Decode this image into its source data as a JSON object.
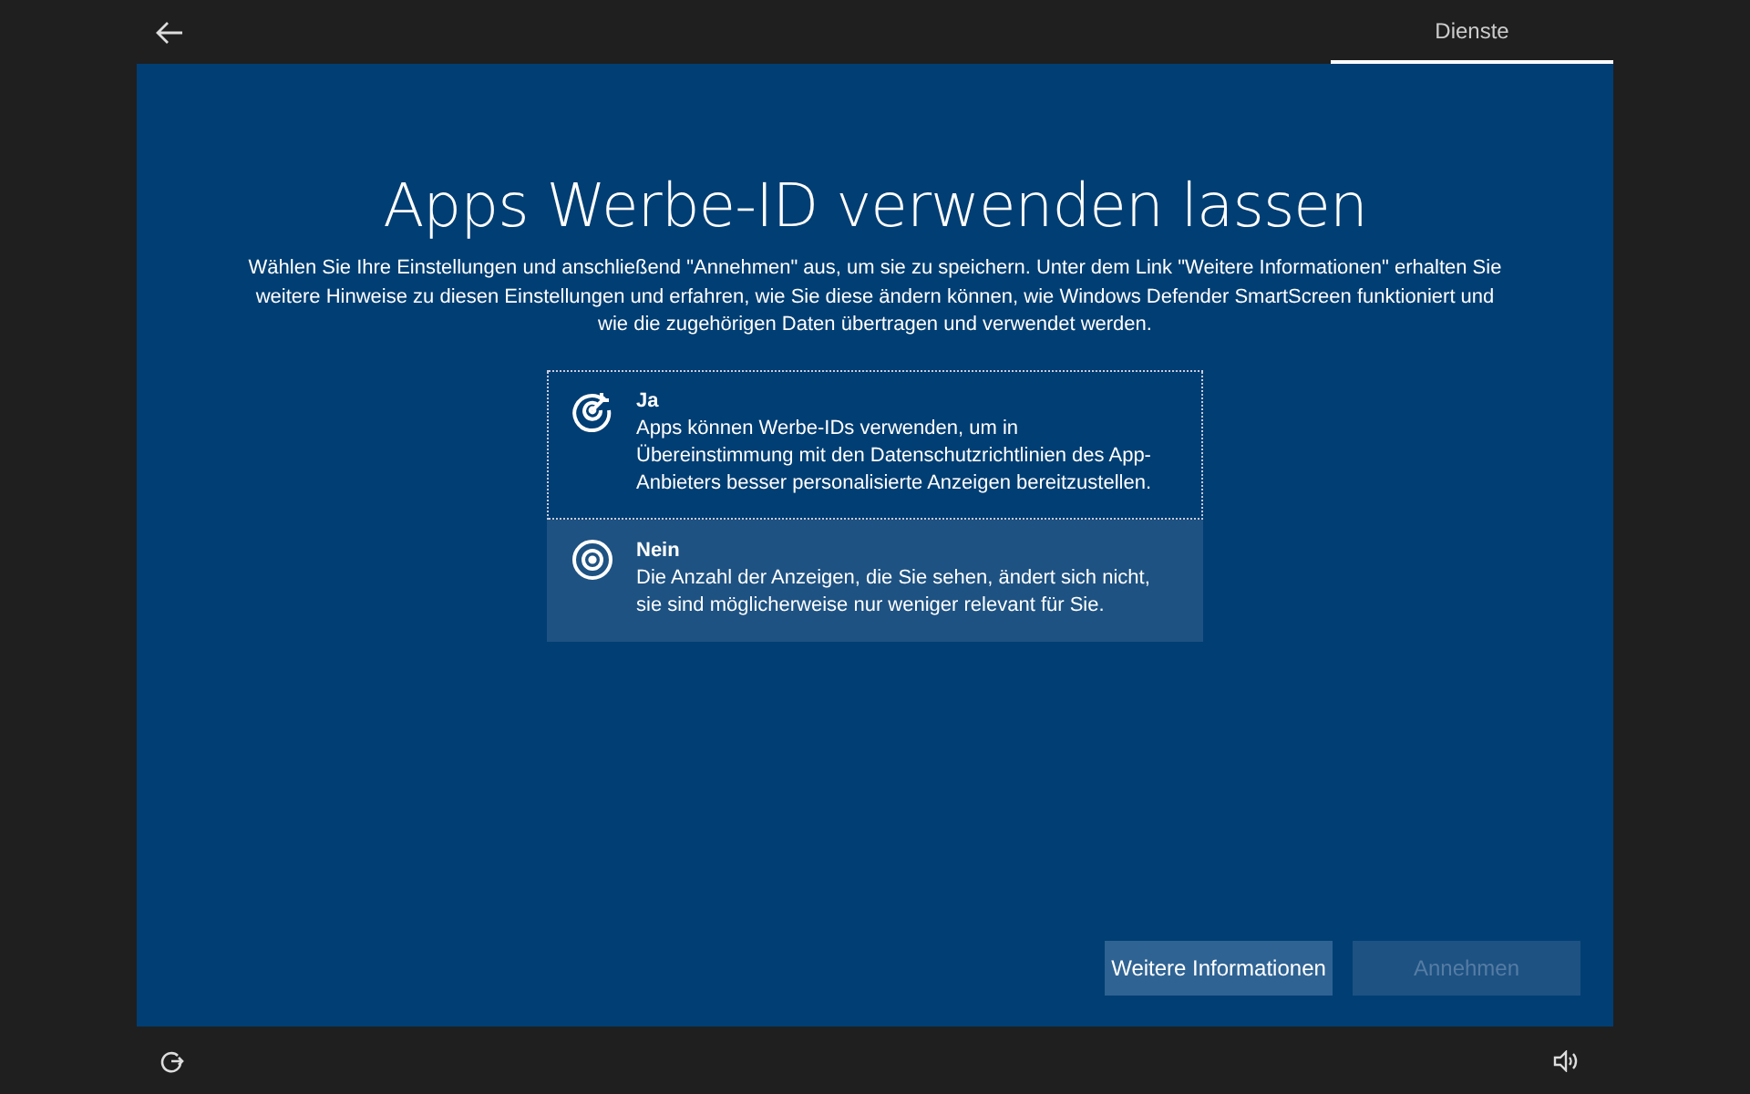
{
  "top_bar": {
    "tabs": [
      {
        "label": "Dienste",
        "selected": true
      }
    ]
  },
  "title": "Apps Werbe-ID verwenden lassen",
  "description": "Wählen Sie Ihre Einstellungen und anschließend \"Annehmen\" aus, um sie zu speichern. Unter dem Link \"Weitere Informationen\" erhalten Sie weitere Hinweise zu diesen Einstellungen und erfahren, wie Sie diese ändern können, wie Windows Defender SmartScreen funktioniert und wie die zugehörigen Daten übertragen und verwendet werden.",
  "options": [
    {
      "kind": "yes",
      "label": "Ja",
      "text": "Apps können Werbe-IDs verwenden, um in Übereinstimmung mit den Datenschutzrichtlinien des App-Anbieters besser personalisierte Anzeigen bereitzustellen.",
      "selected": false,
      "focused": true
    },
    {
      "kind": "no",
      "label": "Nein",
      "text": "Die Anzahl der Anzeigen, die Sie sehen, ändert sich nicht, sie sind möglicherweise nur weniger relevant für Sie.",
      "selected": true,
      "focused": false
    }
  ],
  "buttons": [
    {
      "label": "Weitere Informationen",
      "disabled": false
    },
    {
      "label": "Annehmen",
      "disabled": true
    }
  ]
}
